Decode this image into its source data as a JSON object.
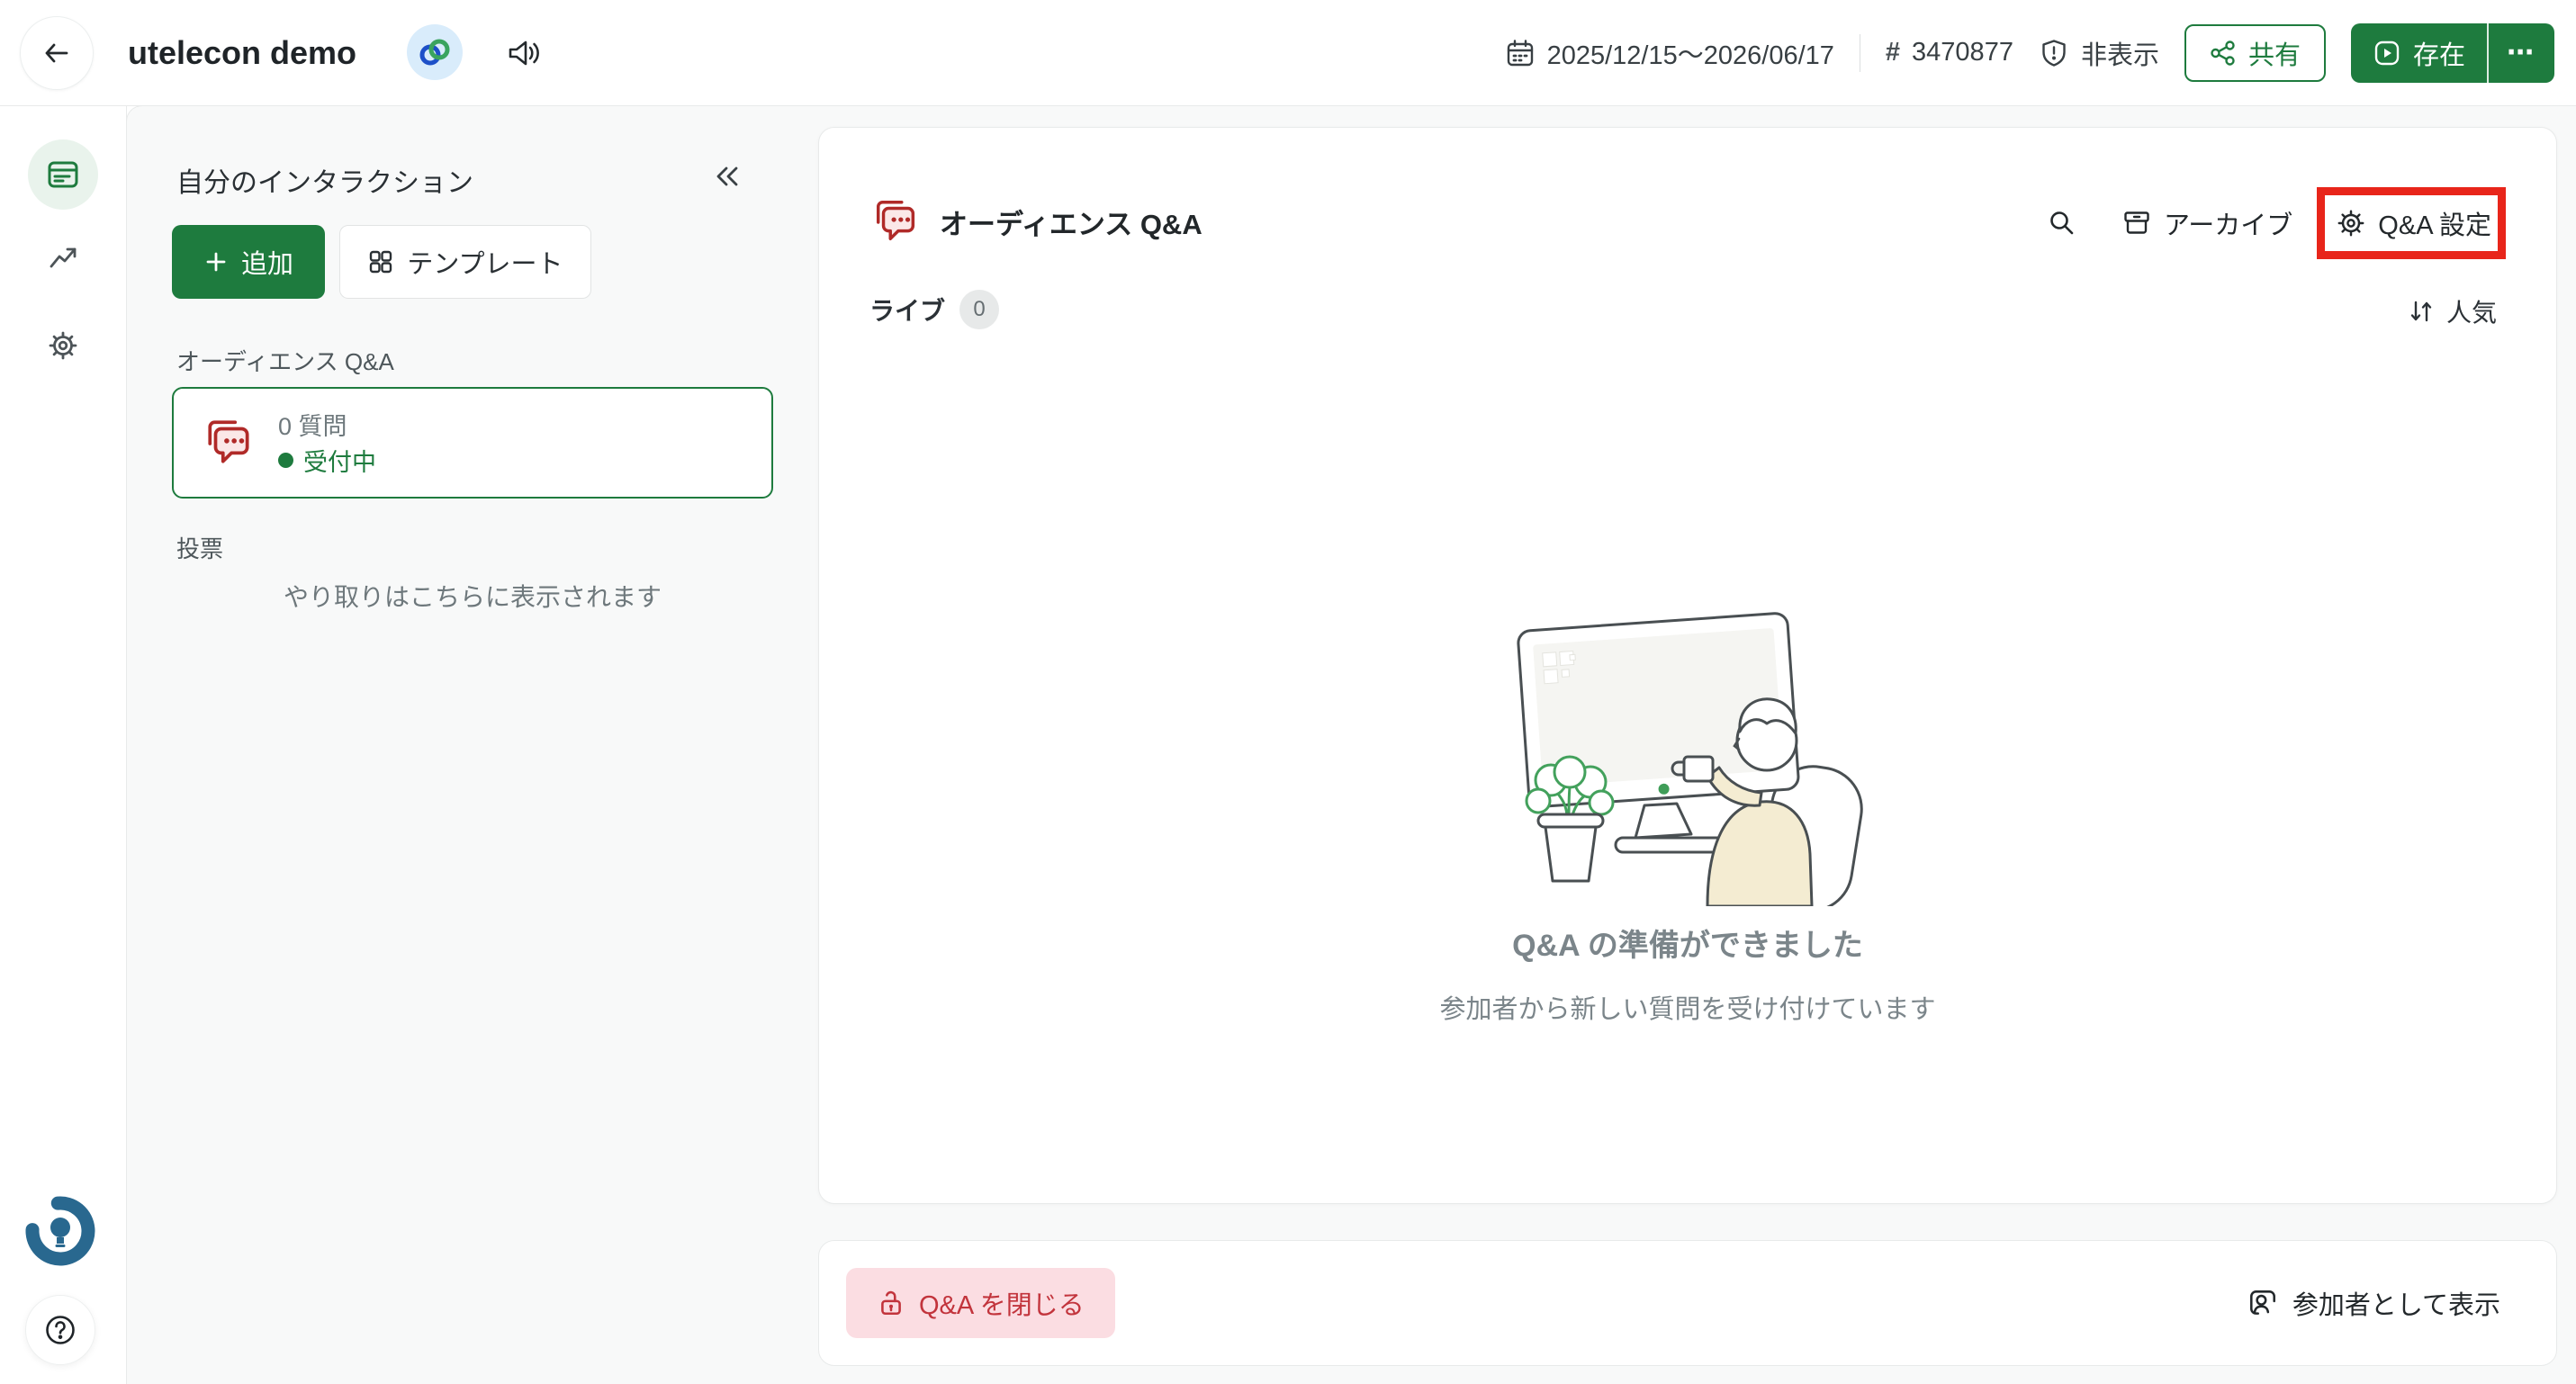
{
  "topbar": {
    "title": "utelecon demo",
    "date_range": "2025/12/15〜2026/06/17",
    "hash_symbol": "#",
    "event_code": "3470877",
    "visibility_label": "非表示",
    "share_label": "共有",
    "present_label": "存在",
    "more_label": "⋯"
  },
  "left_panel": {
    "heading": "自分のインタラクション",
    "add_button": "追加",
    "template_button": "テンプレート",
    "qa_section_label": "オーディエンス Q&A",
    "qa_card": {
      "count": "0 質問",
      "status": "受付中"
    },
    "polls_section_label": "投票",
    "empty_hint": "やり取りはこちらに表示されます"
  },
  "main_panel": {
    "title": "オーディエンス Q&A",
    "archive_label": "アーカイブ",
    "settings_label": "Q&A 設定",
    "live_tab": "ライブ",
    "live_count": "0",
    "sort_label": "人気",
    "empty_title": "Q&A の準備ができました",
    "empty_subtitle": "参加者から新しい質問を受け付けています"
  },
  "footer": {
    "close_qa_label": "Q&A を閉じる",
    "view_as_participant_label": "参加者として表示"
  },
  "colors": {
    "accent_green": "#1e7b3e",
    "qa_icon_red": "#b02a28",
    "annotation_red": "#e8251a",
    "close_button_bg": "#fbdde2",
    "close_button_text": "#c2343c",
    "slido_logo_blue": "#29688f"
  }
}
